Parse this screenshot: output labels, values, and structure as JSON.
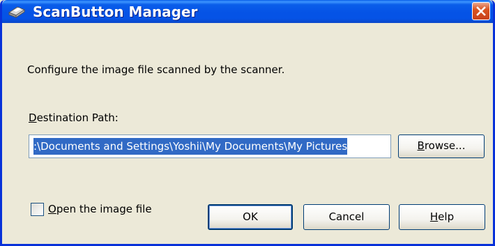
{
  "window": {
    "title": "ScanButton Manager",
    "title_icon": "scanner-icon",
    "close_icon": "close-icon"
  },
  "dialog": {
    "description": "Configure the image file scanned by the scanner.",
    "destination_label_underlined": "D",
    "destination_label_rest": "estination Path:",
    "destination_value": ":\\Documents and Settings\\Yoshii\\My Documents\\My Pictures",
    "browse_underlined": "B",
    "browse_rest": "rowse...",
    "open_file_underlined": "O",
    "open_file_rest": "pen the image file",
    "open_file_checked": false,
    "ok_label": "OK",
    "cancel_label": "Cancel",
    "help_underlined": "H",
    "help_rest": "elp"
  },
  "colors": {
    "title_bar": "#0553E6",
    "dialog_bg": "#ECE9D8",
    "selection": "#316AC5",
    "close_button": "#D9531F"
  }
}
